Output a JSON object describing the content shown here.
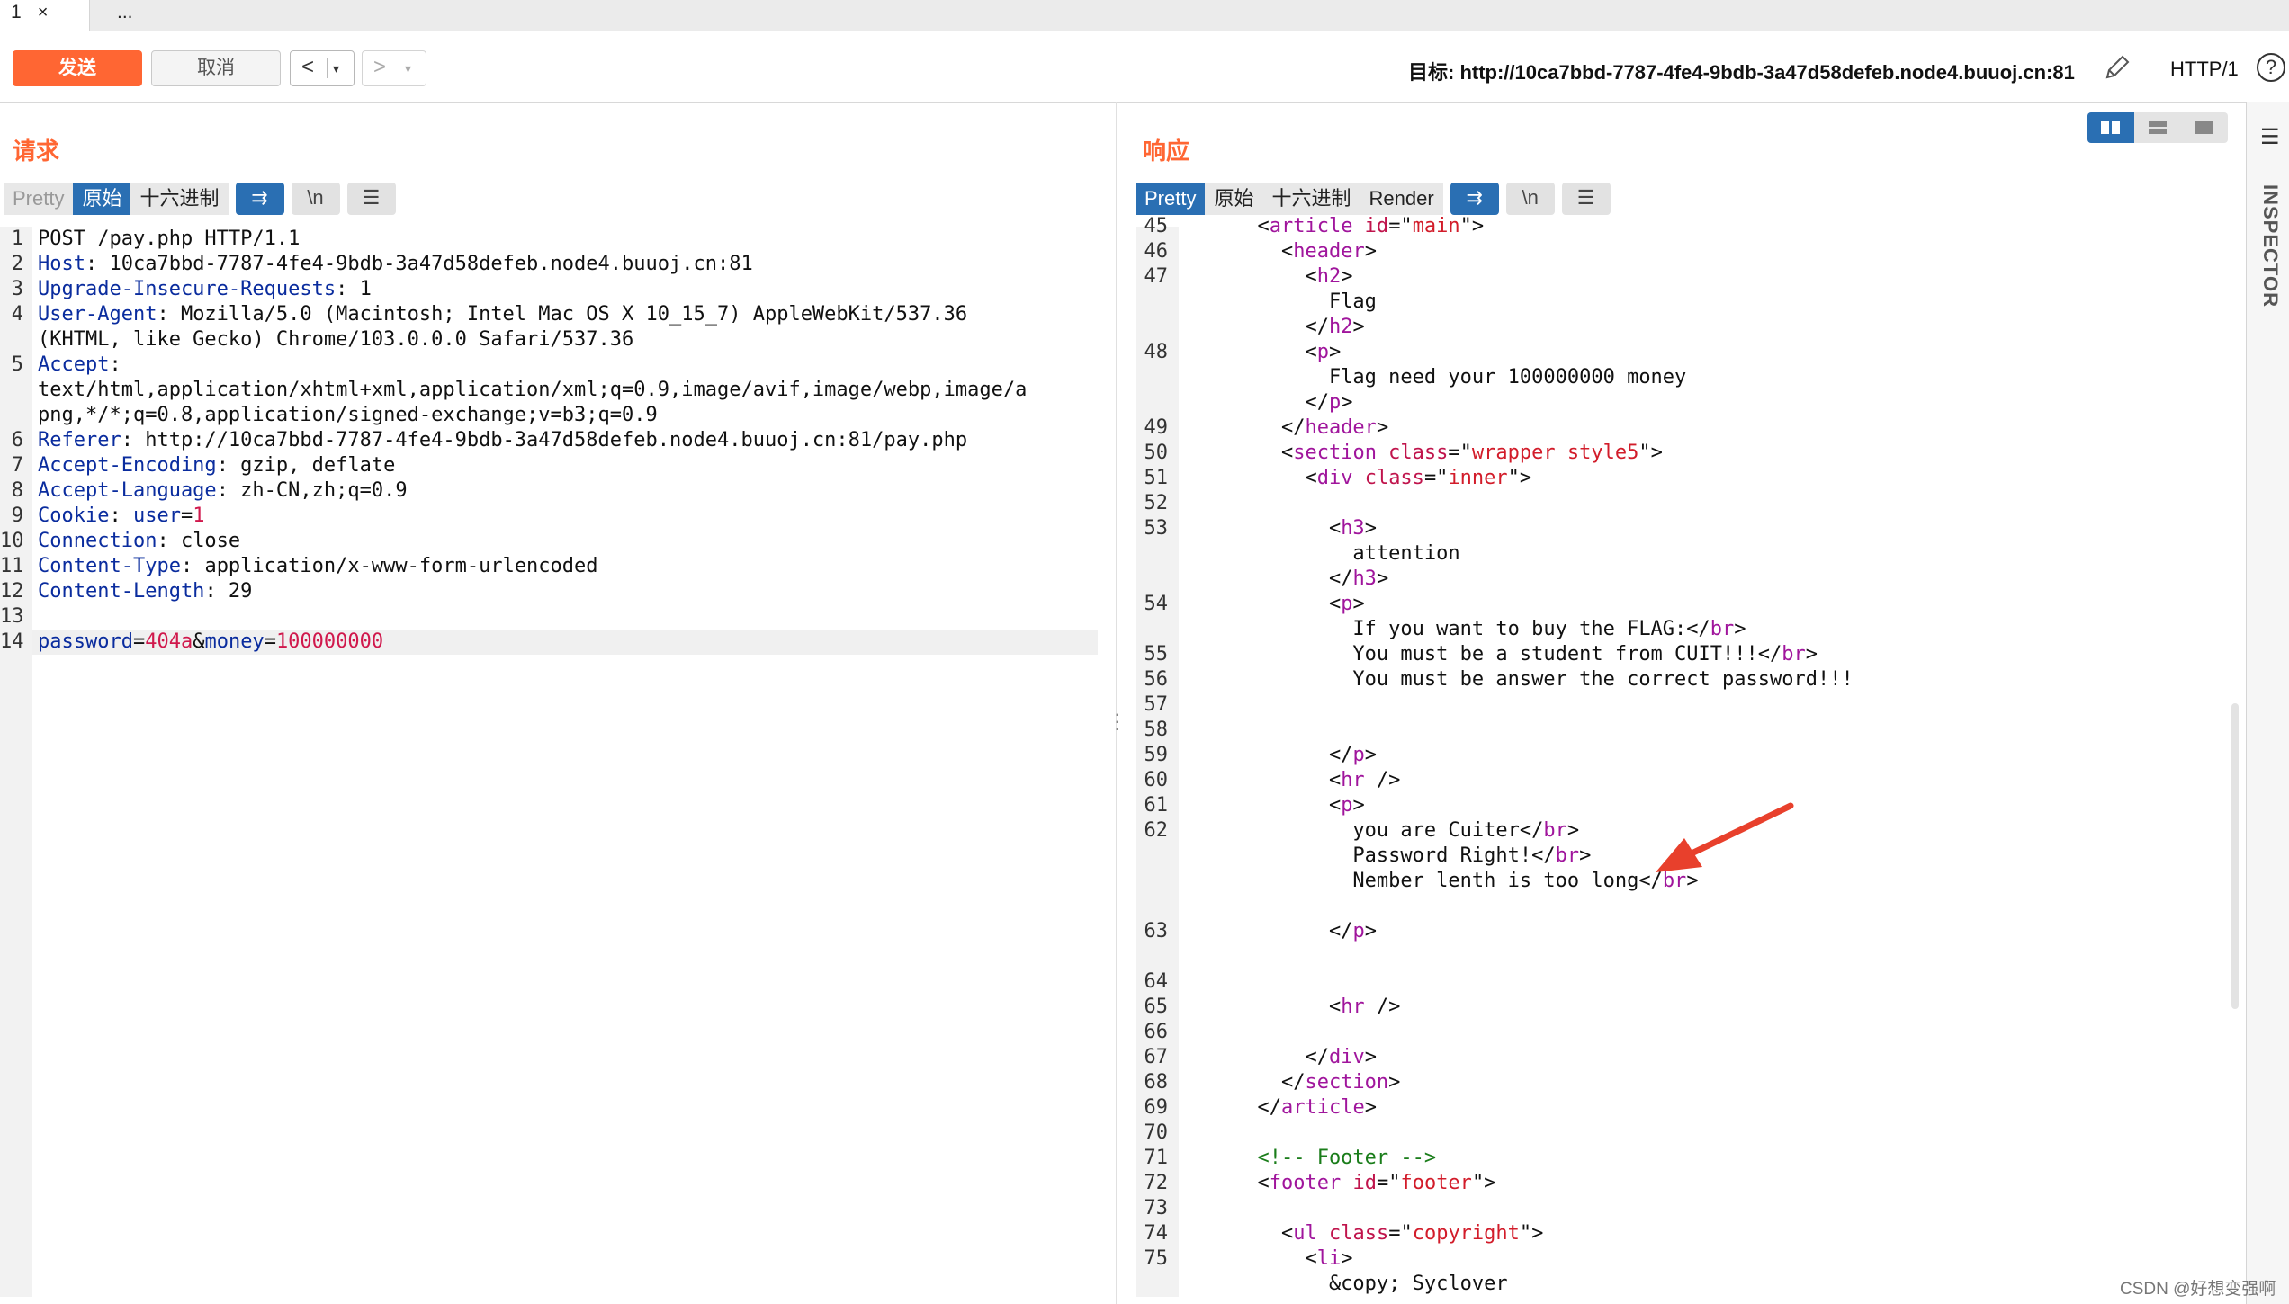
{
  "tabs": [
    {
      "label": "1",
      "close": "×"
    },
    {
      "label": "..."
    }
  ],
  "toolbar": {
    "send": "发送",
    "cancel": "取消",
    "back": "<",
    "forward": ">",
    "dropdown": "▾",
    "target": "目标: http://10ca7bbd-7787-4fe4-9bdb-3a47d58defeb.node4.buuoj.cn:81",
    "protocol": "HTTP/1",
    "help": "?"
  },
  "request": {
    "title": "请求",
    "tabs": [
      "Pretty",
      "原始",
      "十六进制"
    ],
    "newline_label": "\\n",
    "lines": [
      {
        "n": "1",
        "parts": [
          [
            "v",
            "POST /pay.php HTTP/1.1"
          ]
        ]
      },
      {
        "n": "2",
        "parts": [
          [
            "k",
            "Host"
          ],
          [
            "v",
            ": 10ca7bbd-7787-4fe4-9bdb-3a47d58defeb.node4.buuoj.cn:81"
          ]
        ]
      },
      {
        "n": "3",
        "parts": [
          [
            "k",
            "Upgrade-Insecure-Requests"
          ],
          [
            "v",
            ": 1"
          ]
        ]
      },
      {
        "n": "4",
        "parts": [
          [
            "k",
            "User-Agent"
          ],
          [
            "v",
            ": Mozilla/5.0 (Macintosh; Intel Mac OS X 10_15_7) AppleWebKit/537.36"
          ]
        ]
      },
      {
        "n": "",
        "parts": [
          [
            "v",
            "(KHTML, like Gecko) Chrome/103.0.0.0 Safari/537.36"
          ]
        ]
      },
      {
        "n": "5",
        "parts": [
          [
            "k",
            "Accept"
          ],
          [
            "v",
            ":"
          ]
        ]
      },
      {
        "n": "",
        "parts": [
          [
            "v",
            "text/html,application/xhtml+xml,application/xml;q=0.9,image/avif,image/webp,image/a"
          ]
        ]
      },
      {
        "n": "",
        "parts": [
          [
            "v",
            "png,*/*;q=0.8,application/signed-exchange;v=b3;q=0.9"
          ]
        ]
      },
      {
        "n": "6",
        "parts": [
          [
            "k",
            "Referer"
          ],
          [
            "v",
            ": http://10ca7bbd-7787-4fe4-9bdb-3a47d58defeb.node4.buuoj.cn:81/pay.php"
          ]
        ]
      },
      {
        "n": "7",
        "parts": [
          [
            "k",
            "Accept-Encoding"
          ],
          [
            "v",
            ": gzip, deflate"
          ]
        ]
      },
      {
        "n": "8",
        "parts": [
          [
            "k",
            "Accept-Language"
          ],
          [
            "v",
            ": zh-CN,zh;q=0.9"
          ]
        ]
      },
      {
        "n": "9",
        "parts": [
          [
            "k",
            "Cookie"
          ],
          [
            "v",
            ": "
          ],
          [
            "k",
            "user"
          ],
          [
            "v",
            "="
          ],
          [
            "r",
            "1"
          ]
        ]
      },
      {
        "n": "10",
        "parts": [
          [
            "k",
            "Connection"
          ],
          [
            "v",
            ": close"
          ]
        ]
      },
      {
        "n": "11",
        "parts": [
          [
            "k",
            "Content-Type"
          ],
          [
            "v",
            ": application/x-www-form-urlencoded"
          ]
        ]
      },
      {
        "n": "12",
        "parts": [
          [
            "k",
            "Content-Length"
          ],
          [
            "v",
            ": 29"
          ]
        ]
      },
      {
        "n": "13",
        "parts": []
      },
      {
        "n": "14",
        "parts": [
          [
            "k",
            "password"
          ],
          [
            "v",
            "="
          ],
          [
            "r",
            "404a"
          ],
          [
            "v",
            "&"
          ],
          [
            "k",
            "money"
          ],
          [
            "v",
            "="
          ],
          [
            "r",
            "100000000"
          ]
        ]
      }
    ]
  },
  "response": {
    "title": "响应",
    "tabs": [
      "Pretty",
      "原始",
      "十六进制",
      "Render"
    ],
    "newline_label": "\\n",
    "lines": [
      {
        "n": "45",
        "parts": [
          [
            "v",
            "      <"
          ],
          [
            "t",
            "article"
          ],
          [
            "ta",
            " id"
          ],
          [
            "v",
            "=\""
          ],
          [
            "av",
            "main"
          ],
          [
            "v",
            "\">"
          ]
        ]
      },
      {
        "n": "46",
        "parts": [
          [
            "v",
            "        <"
          ],
          [
            "t",
            "header"
          ],
          [
            "v",
            ">"
          ]
        ]
      },
      {
        "n": "47",
        "parts": [
          [
            "v",
            "          <"
          ],
          [
            "t",
            "h2"
          ],
          [
            "v",
            ">"
          ]
        ]
      },
      {
        "n": "",
        "parts": [
          [
            "v",
            "            Flag"
          ]
        ]
      },
      {
        "n": "",
        "parts": [
          [
            "v",
            "          </"
          ],
          [
            "t",
            "h2"
          ],
          [
            "v",
            ">"
          ]
        ]
      },
      {
        "n": "48",
        "parts": [
          [
            "v",
            "          <"
          ],
          [
            "t",
            "p"
          ],
          [
            "v",
            ">"
          ]
        ]
      },
      {
        "n": "",
        "parts": [
          [
            "v",
            "            Flag need your 100000000 money"
          ]
        ]
      },
      {
        "n": "",
        "parts": [
          [
            "v",
            "          </"
          ],
          [
            "t",
            "p"
          ],
          [
            "v",
            ">"
          ]
        ]
      },
      {
        "n": "49",
        "parts": [
          [
            "v",
            "        </"
          ],
          [
            "t",
            "header"
          ],
          [
            "v",
            ">"
          ]
        ]
      },
      {
        "n": "50",
        "parts": [
          [
            "v",
            "        <"
          ],
          [
            "t",
            "section"
          ],
          [
            "ta",
            " class"
          ],
          [
            "v",
            "=\""
          ],
          [
            "av",
            "wrapper style5"
          ],
          [
            "v",
            "\">"
          ]
        ]
      },
      {
        "n": "51",
        "parts": [
          [
            "v",
            "          <"
          ],
          [
            "t",
            "div"
          ],
          [
            "ta",
            " class"
          ],
          [
            "v",
            "=\""
          ],
          [
            "av",
            "inner"
          ],
          [
            "v",
            "\">"
          ]
        ]
      },
      {
        "n": "52",
        "parts": []
      },
      {
        "n": "53",
        "parts": [
          [
            "v",
            "            <"
          ],
          [
            "t",
            "h3"
          ],
          [
            "v",
            ">"
          ]
        ]
      },
      {
        "n": "",
        "parts": [
          [
            "v",
            "              attention"
          ]
        ]
      },
      {
        "n": "",
        "parts": [
          [
            "v",
            "            </"
          ],
          [
            "t",
            "h3"
          ],
          [
            "v",
            ">"
          ]
        ]
      },
      {
        "n": "54",
        "parts": [
          [
            "v",
            "            <"
          ],
          [
            "t",
            "p"
          ],
          [
            "v",
            ">"
          ]
        ]
      },
      {
        "n": "",
        "parts": [
          [
            "v",
            "              If you want to buy the FLAG:</"
          ],
          [
            "t",
            "br"
          ],
          [
            "v",
            ">"
          ]
        ]
      },
      {
        "n": "55",
        "parts": [
          [
            "v",
            "              You must be a student from CUIT!!!</"
          ],
          [
            "t",
            "br"
          ],
          [
            "v",
            ">"
          ]
        ]
      },
      {
        "n": "56",
        "parts": [
          [
            "v",
            "              You must be answer the correct password!!!"
          ]
        ]
      },
      {
        "n": "57",
        "parts": []
      },
      {
        "n": "58",
        "parts": []
      },
      {
        "n": "59",
        "parts": [
          [
            "v",
            "            </"
          ],
          [
            "t",
            "p"
          ],
          [
            "v",
            ">"
          ]
        ]
      },
      {
        "n": "60",
        "parts": [
          [
            "v",
            "            <"
          ],
          [
            "t",
            "hr"
          ],
          [
            "v",
            " />"
          ]
        ]
      },
      {
        "n": "61",
        "parts": [
          [
            "v",
            "            <"
          ],
          [
            "t",
            "p"
          ],
          [
            "v",
            ">"
          ]
        ]
      },
      {
        "n": "62",
        "parts": [
          [
            "v",
            "              you are Cuiter</"
          ],
          [
            "t",
            "br"
          ],
          [
            "v",
            ">"
          ]
        ]
      },
      {
        "n": "",
        "parts": [
          [
            "v",
            "              Password Right!</"
          ],
          [
            "t",
            "br"
          ],
          [
            "v",
            ">"
          ]
        ]
      },
      {
        "n": "",
        "parts": [
          [
            "v",
            "              Nember lenth is too long</"
          ],
          [
            "t",
            "br"
          ],
          [
            "v",
            ">"
          ]
        ]
      },
      {
        "n": "",
        "parts": []
      },
      {
        "n": "63",
        "parts": [
          [
            "v",
            "            </"
          ],
          [
            "t",
            "p"
          ],
          [
            "v",
            ">"
          ]
        ]
      },
      {
        "n": "",
        "parts": []
      },
      {
        "n": "64",
        "parts": []
      },
      {
        "n": "65",
        "parts": [
          [
            "v",
            "            <"
          ],
          [
            "t",
            "hr"
          ],
          [
            "v",
            " />"
          ]
        ]
      },
      {
        "n": "66",
        "parts": []
      },
      {
        "n": "67",
        "parts": [
          [
            "v",
            "          </"
          ],
          [
            "t",
            "div"
          ],
          [
            "v",
            ">"
          ]
        ]
      },
      {
        "n": "68",
        "parts": [
          [
            "v",
            "        </"
          ],
          [
            "t",
            "section"
          ],
          [
            "v",
            ">"
          ]
        ]
      },
      {
        "n": "69",
        "parts": [
          [
            "v",
            "      </"
          ],
          [
            "t",
            "article"
          ],
          [
            "v",
            ">"
          ]
        ]
      },
      {
        "n": "70",
        "parts": []
      },
      {
        "n": "71",
        "parts": [
          [
            "c",
            "      <!-- Footer -->"
          ]
        ]
      },
      {
        "n": "72",
        "parts": [
          [
            "v",
            "      <"
          ],
          [
            "t",
            "footer"
          ],
          [
            "ta",
            " id"
          ],
          [
            "v",
            "=\""
          ],
          [
            "av",
            "footer"
          ],
          [
            "v",
            "\">"
          ]
        ]
      },
      {
        "n": "73",
        "parts": []
      },
      {
        "n": "74",
        "parts": [
          [
            "v",
            "        <"
          ],
          [
            "t",
            "ul"
          ],
          [
            "ta",
            " class"
          ],
          [
            "v",
            "=\""
          ],
          [
            "av",
            "copyright"
          ],
          [
            "v",
            "\">"
          ]
        ]
      },
      {
        "n": "75",
        "parts": [
          [
            "v",
            "          <"
          ],
          [
            "t",
            "li"
          ],
          [
            "v",
            ">"
          ]
        ]
      },
      {
        "n": "",
        "parts": [
          [
            "v",
            "            &copy; Syclover"
          ]
        ]
      }
    ]
  },
  "sidebar": {
    "inspector": "INSPECTOR"
  },
  "watermark": "CSDN @好想变强啊",
  "colors": {
    "accent": "#ff6633",
    "active_tab": "#2a6fb3",
    "arrow": "#e8402c"
  }
}
